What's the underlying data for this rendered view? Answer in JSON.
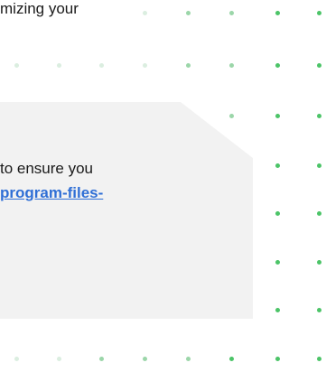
{
  "top_text": "mizing your",
  "card": {
    "body_text": "to ensure you",
    "link_text": "program-files-"
  },
  "colors": {
    "card_bg": "#f2f2f2",
    "link": "#2f6fd6",
    "dot_light": "#dbeee0",
    "dot_mid": "#9bd6a9",
    "dot_strong": "#4cc468"
  }
}
